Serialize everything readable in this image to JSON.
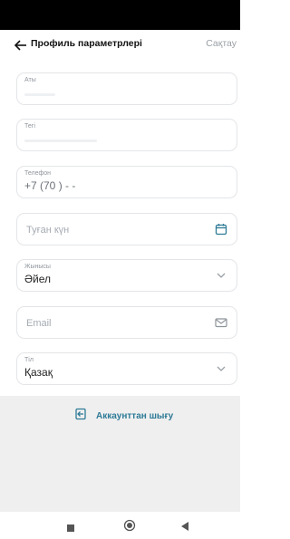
{
  "header": {
    "title": "Профиль параметрлері",
    "save_label": "Сақтау"
  },
  "fields": {
    "first_name": {
      "label": "Аты"
    },
    "last_name": {
      "label": "Тегі"
    },
    "phone": {
      "label": "Телефон",
      "value": "+7 (70  )     -    -"
    },
    "birth_date": {
      "placeholder": "Туған күн",
      "icon": "calendar-icon"
    },
    "gender": {
      "label": "Жынысы",
      "value": "Әйел",
      "icon": "chevron-down-icon"
    },
    "email": {
      "placeholder": "Email",
      "icon": "envelope-icon"
    },
    "language": {
      "label": "Тіл",
      "value": "Қазақ",
      "icon": "chevron-down-icon"
    }
  },
  "logout": {
    "label": "Аккаунттан шығу",
    "icon": "logout-icon"
  },
  "nav": {
    "icons": [
      "square-icon",
      "circle-icon",
      "back-triangle-icon"
    ]
  },
  "colors": {
    "accent": "#2d7a96",
    "border": "#e3e5e8",
    "placeholder": "#a5abb2"
  }
}
